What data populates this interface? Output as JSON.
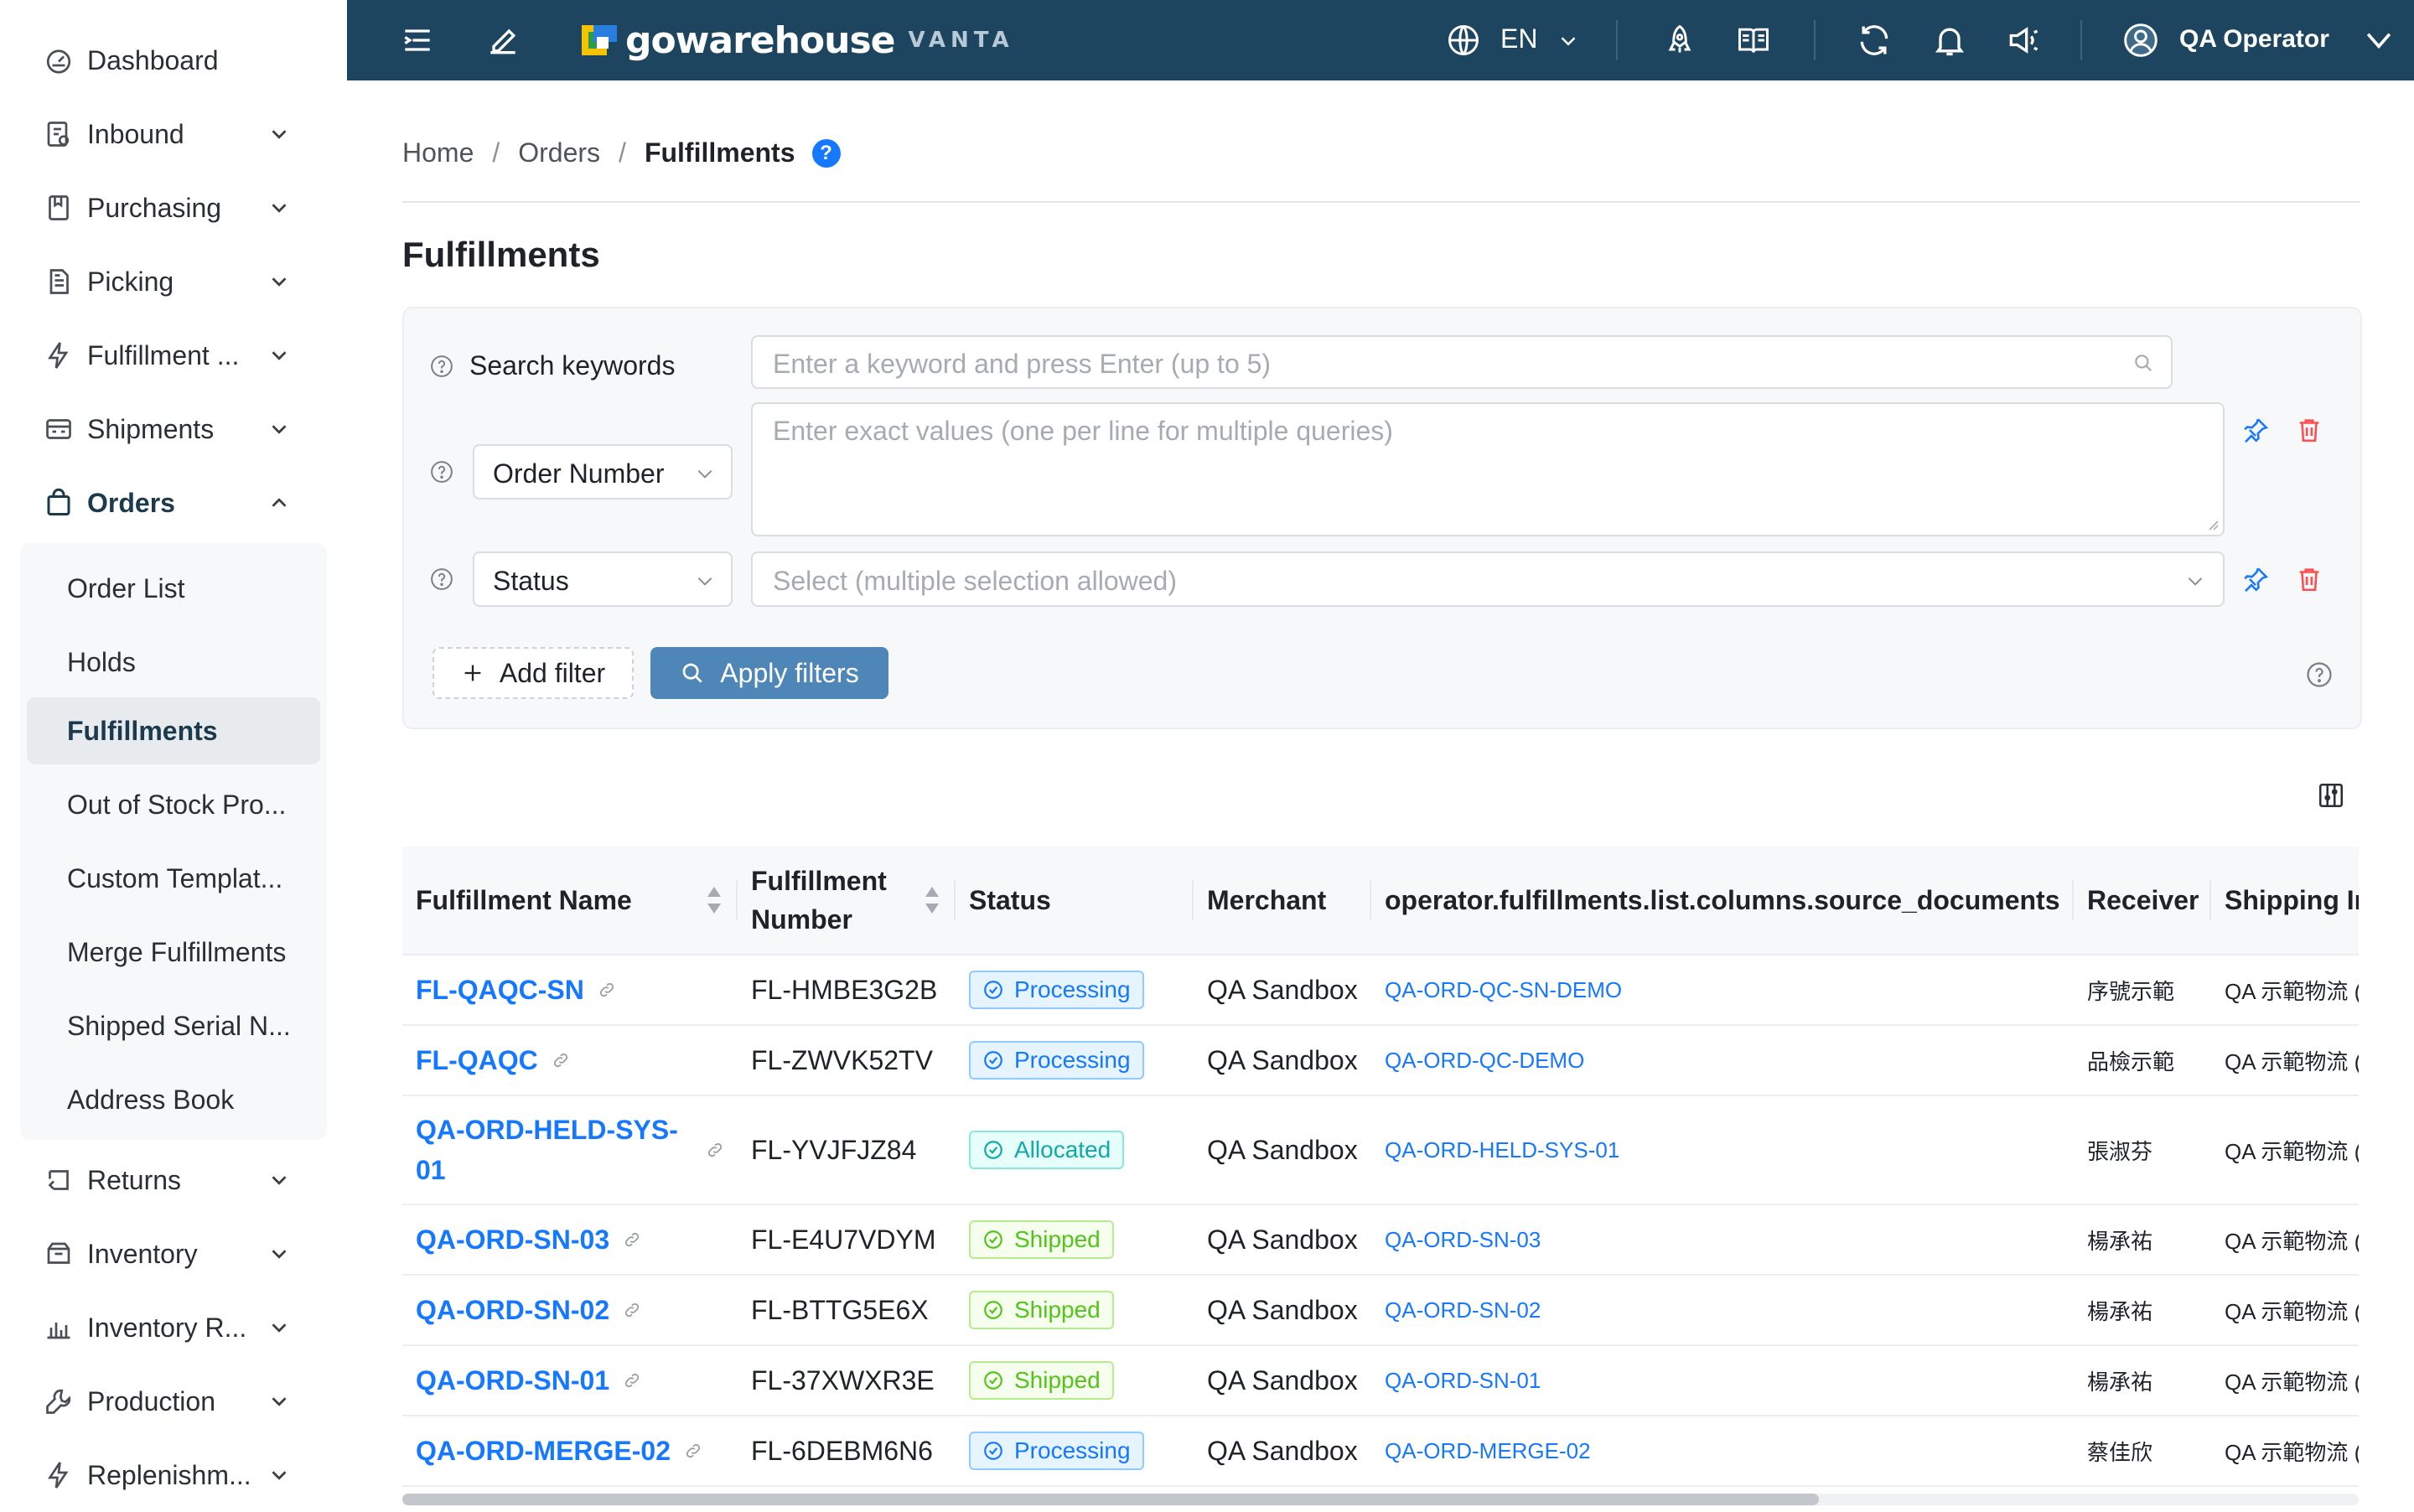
{
  "sidebar": {
    "items": [
      {
        "label": "Dashboard",
        "icon": "dashboard-icon"
      },
      {
        "label": "Inbound",
        "icon": "inbound-icon"
      },
      {
        "label": "Purchasing",
        "icon": "purchasing-icon"
      },
      {
        "label": "Picking",
        "icon": "picking-icon"
      },
      {
        "label": "Fulfillment ...",
        "icon": "lightning-icon"
      },
      {
        "label": "Shipments",
        "icon": "truck-icon"
      },
      {
        "label": "Orders",
        "icon": "bag-icon"
      },
      {
        "label": "Returns",
        "icon": "return-icon"
      },
      {
        "label": "Inventory",
        "icon": "inventory-icon"
      },
      {
        "label": "Inventory R...",
        "icon": "bar-chart-icon"
      },
      {
        "label": "Production",
        "icon": "wrench-icon"
      },
      {
        "label": "Replenishm...",
        "icon": "lightning-icon"
      }
    ],
    "orders_submenu": [
      "Order List",
      "Holds",
      "Fulfillments",
      "Out of Stock Pro...",
      "Custom Templat...",
      "Merge Fulfillments",
      "Shipped Serial N...",
      "Address Book"
    ]
  },
  "topbar": {
    "brand": "gowarehouse",
    "brand_sub": "VANTA",
    "language": "EN",
    "user": "QA Operator"
  },
  "breadcrumb": [
    "Home",
    "Orders",
    "Fulfillments"
  ],
  "page_title": "Fulfillments",
  "filters": {
    "search_label": "Search keywords",
    "search_placeholder": "Enter a keyword and press Enter (up to 5)",
    "order_number_field": "Order Number",
    "order_number_placeholder": "Enter exact values (one per line for multiple queries)",
    "status_field": "Status",
    "status_placeholder": "Select (multiple selection allowed)",
    "add_filter": "Add filter",
    "apply_filters": "Apply filters"
  },
  "table": {
    "columns": [
      "Fulfillment Name",
      "Fulfillment Number",
      "Status",
      "Merchant",
      "operator.fulfillments.list.columns.source_documents",
      "Receiver",
      "Shipping In"
    ],
    "rows": [
      {
        "name": "FL-QAQC-SN",
        "number": "FL-HMBE3G2B",
        "status": "Processing",
        "status_kind": "processing",
        "merchant": "QA Sandbox",
        "source": "QA-ORD-QC-SN-DEMO",
        "receiver": "序號示範",
        "shipping": "QA 示範物流 (O"
      },
      {
        "name": "FL-QAQC",
        "number": "FL-ZWVK52TV",
        "status": "Processing",
        "status_kind": "processing",
        "merchant": "QA Sandbox",
        "source": "QA-ORD-QC-DEMO",
        "receiver": "品檢示範",
        "shipping": "QA 示範物流 (O"
      },
      {
        "name": "QA-ORD-HELD-SYS-01",
        "number": "FL-YVJFJZ84",
        "status": "Allocated",
        "status_kind": "allocated",
        "merchant": "QA Sandbox",
        "source": "QA-ORD-HELD-SYS-01",
        "receiver": "張淑芬",
        "shipping": "QA 示範物流 (O"
      },
      {
        "name": "QA-ORD-SN-03",
        "number": "FL-E4U7VDYM",
        "status": "Shipped",
        "status_kind": "shipped",
        "merchant": "QA Sandbox",
        "source": "QA-ORD-SN-03",
        "receiver": "楊承祐",
        "shipping": "QA 示範物流 (O"
      },
      {
        "name": "QA-ORD-SN-02",
        "number": "FL-BTTG5E6X",
        "status": "Shipped",
        "status_kind": "shipped",
        "merchant": "QA Sandbox",
        "source": "QA-ORD-SN-02",
        "receiver": "楊承祐",
        "shipping": "QA 示範物流 (O"
      },
      {
        "name": "QA-ORD-SN-01",
        "number": "FL-37XWXR3E",
        "status": "Shipped",
        "status_kind": "shipped",
        "merchant": "QA Sandbox",
        "source": "QA-ORD-SN-01",
        "receiver": "楊承祐",
        "shipping": "QA 示範物流 (O"
      },
      {
        "name": "QA-ORD-MERGE-02",
        "number": "FL-6DEBM6N6",
        "status": "Processing",
        "status_kind": "processing",
        "merchant": "QA Sandbox",
        "source": "QA-ORD-MERGE-02",
        "receiver": "蔡佳欣",
        "shipping": "QA 示範物流 (O"
      }
    ]
  },
  "colors": {
    "topbar": "#1d4560",
    "link": "#1677ff",
    "primary_button": "#4f86b8",
    "danger": "#ff4d4f"
  }
}
